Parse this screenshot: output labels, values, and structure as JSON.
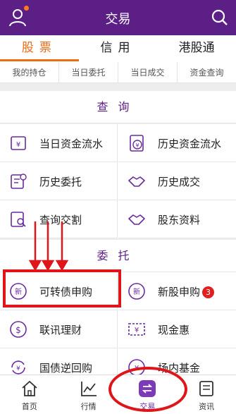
{
  "header": {
    "title": "交易",
    "accent_color": "#5b1f86"
  },
  "tabs": [
    {
      "label": "股票",
      "active": true
    },
    {
      "label": "信用",
      "active": false
    },
    {
      "label": "港股通",
      "active": false
    }
  ],
  "shortcuts": [
    "我的持仓",
    "当日委托",
    "当日成交",
    "资金查询"
  ],
  "query_section": {
    "title": "查询",
    "items": [
      {
        "label": "当日资金流水",
        "icon": "yen-document-icon"
      },
      {
        "label": "历史资金流水",
        "icon": "yen-document-icon"
      },
      {
        "label": "历史委托",
        "icon": "clock-document-icon"
      },
      {
        "label": "历史成交",
        "icon": "handshake-icon"
      },
      {
        "label": "查询交割",
        "icon": "search-document-icon"
      },
      {
        "label": "股东资料",
        "icon": "handshake-icon"
      }
    ]
  },
  "order_section": {
    "title": "委托",
    "items": [
      {
        "label": "可转债申购",
        "icon": "new-icon"
      },
      {
        "label": "新股申购",
        "icon": "new-icon",
        "badge": "3"
      },
      {
        "label": "联讯理财",
        "icon": "yen-coin-icon"
      },
      {
        "label": "现金惠",
        "icon": "yen-ticket-icon"
      },
      {
        "label": "国债逆回购",
        "icon": "yen-cycle-icon"
      },
      {
        "label": "场内基金",
        "icon": "yen-coin-icon"
      }
    ]
  },
  "bottom_nav": [
    {
      "label": "首页",
      "active": false
    },
    {
      "label": "行情",
      "active": false
    },
    {
      "label": "交易",
      "active": true
    },
    {
      "label": "资讯",
      "active": false
    }
  ],
  "annotation_color": "#e0151a"
}
